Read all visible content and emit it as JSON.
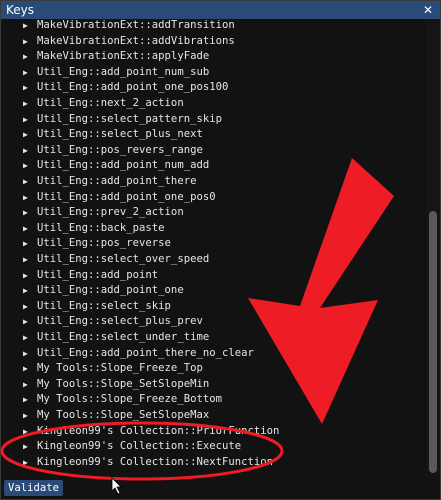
{
  "window": {
    "title": "Keys",
    "close_glyph": "✕"
  },
  "list": {
    "items": [
      "MakeVibrationExt::addTransition",
      "MakeVibrationExt::addVibrations",
      "MakeVibrationExt::applyFade",
      "Util_Eng::add_point_num_sub",
      "Util_Eng::add_point_one_pos100",
      "Util_Eng::next_2_action",
      "Util_Eng::select_pattern_skip",
      "Util_Eng::select_plus_next",
      "Util_Eng::pos_revers_range",
      "Util_Eng::add_point_num_add",
      "Util_Eng::add_point_there",
      "Util_Eng::add_point_one_pos0",
      "Util_Eng::prev_2_action",
      "Util_Eng::back_paste",
      "Util_Eng::pos_reverse",
      "Util_Eng::select_over_speed",
      "Util_Eng::add_point",
      "Util_Eng::add_point_one",
      "Util_Eng::select_skip",
      "Util_Eng::select_plus_prev",
      "Util_Eng::select_under_time",
      "Util_Eng::add_point_there_no_clear",
      "My Tools::Slope_Freeze_Top",
      "My Tools::Slope_SetSlopeMin",
      "My Tools::Slope_Freeze_Bottom",
      "My Tools::Slope_SetSlopeMax",
      "Kingleon99's Collection::PriorFunction",
      "Kingleon99's Collection::Execute",
      "Kingleon99's Collection::NextFunction"
    ]
  },
  "footer": {
    "validate_label": "Validate"
  },
  "colors": {
    "titlebar": "#2a4a78",
    "background": "#121212",
    "text": "#e6e6e6",
    "annotation_red": "#ee1c25"
  },
  "icons": {
    "expand": "triangle-right-icon",
    "close": "close-icon",
    "cursor": "mouse-cursor-icon"
  }
}
